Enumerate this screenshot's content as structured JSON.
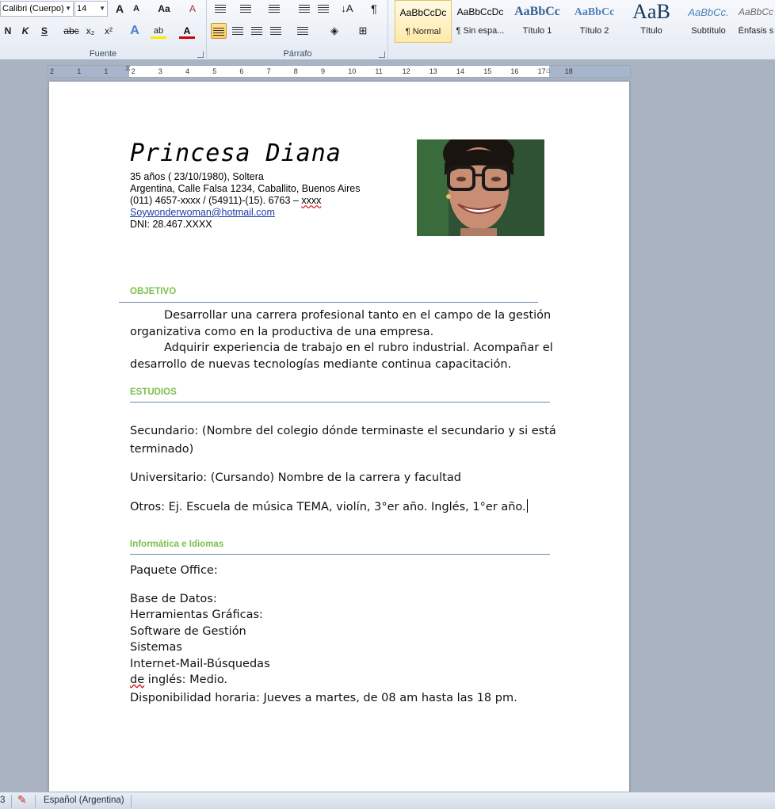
{
  "ribbon": {
    "font": {
      "font_name": "Calibri (Cuerpo)",
      "font_size": "14",
      "grow": "A",
      "shrink": "A",
      "change_case": "Aa",
      "clear_format": "A",
      "bold": "N",
      "italic": "K",
      "underline": "S",
      "strike": "abc",
      "subscript": "x₂",
      "superscript": "x²",
      "text_effects": "A",
      "highlight": "ab",
      "font_color": "A",
      "label": "Fuente"
    },
    "paragraph": {
      "label": "Párrafo",
      "pilcrow": "¶"
    },
    "styles": [
      {
        "sample": "AaBbCcDc",
        "name": "¶ Normal"
      },
      {
        "sample": "AaBbCcDc",
        "name": "¶ Sin espa..."
      },
      {
        "sample": "AaBbCc",
        "name": "Título 1"
      },
      {
        "sample": "AaBbCc",
        "name": "Título 2"
      },
      {
        "sample": "AaB",
        "name": "Título"
      },
      {
        "sample": "AaBbCc.",
        "name": "Subtítulo"
      },
      {
        "sample": "AaBbCc",
        "name": "Énfasis s"
      }
    ]
  },
  "ruler": {
    "ticks": [
      "2",
      "1",
      "1",
      "2",
      "3",
      "4",
      "5",
      "6",
      "7",
      "8",
      "9",
      "10",
      "11",
      "12",
      "13",
      "14",
      "15",
      "16",
      "17",
      "18"
    ]
  },
  "document": {
    "name": "Princesa Diana",
    "info": [
      "35 años ( 23/10/1980),  Soltera",
      "Argentina, Calle Falsa 1234,  Caballito, Buenos Aires",
      "(011) 4657-xxxx / (54911)-(15).  6763 – "
    ],
    "phone_tail": "xxxx",
    "email": "Soywonderwoman@hotmail.com",
    "dni": "DNI: 28.467.XXXX",
    "objetivo": {
      "heading": "OBJETIVO",
      "p1_line1": "Desarrollar una carrera profesional tanto en el campo de la gestión",
      "p1_line2": "organizativa como en la productiva de una empresa.",
      "p2_line1": "Adquirir experiencia de trabajo en el rubro industrial. Acompañar el",
      "p2_line2": "desarrollo de nuevas tecnologías mediante continua capacitación."
    },
    "estudios": {
      "heading": "ESTUDIOS",
      "secundario_1": "Secundario: (Nombre del colegio dónde terminaste el secundario y si está",
      "secundario_2": "terminado)",
      "universitario": "Universitario: (Cursando) Nombre de la carrera y facultad",
      "otros": "Otros: Ej.  Escuela de música TEMA, violín, 3°er año. Inglés, 1°er año."
    },
    "informatica": {
      "heading": "Informática e Idiomas",
      "paquete": "Paquete Office:",
      "items": [
        "Base de Datos:",
        "Herramientas Gráficas:",
        "Software de Gestión",
        "Sistemas",
        "Internet-Mail-Búsquedas"
      ],
      "ingles_prefix": "de",
      "ingles_rest": " inglés: Medio.",
      "disponibilidad": "Disponibilidad horaria: Jueves a martes, de 08 am hasta las 18 pm."
    }
  },
  "status": {
    "page_fragment": "3",
    "language": "Español (Argentina)"
  }
}
